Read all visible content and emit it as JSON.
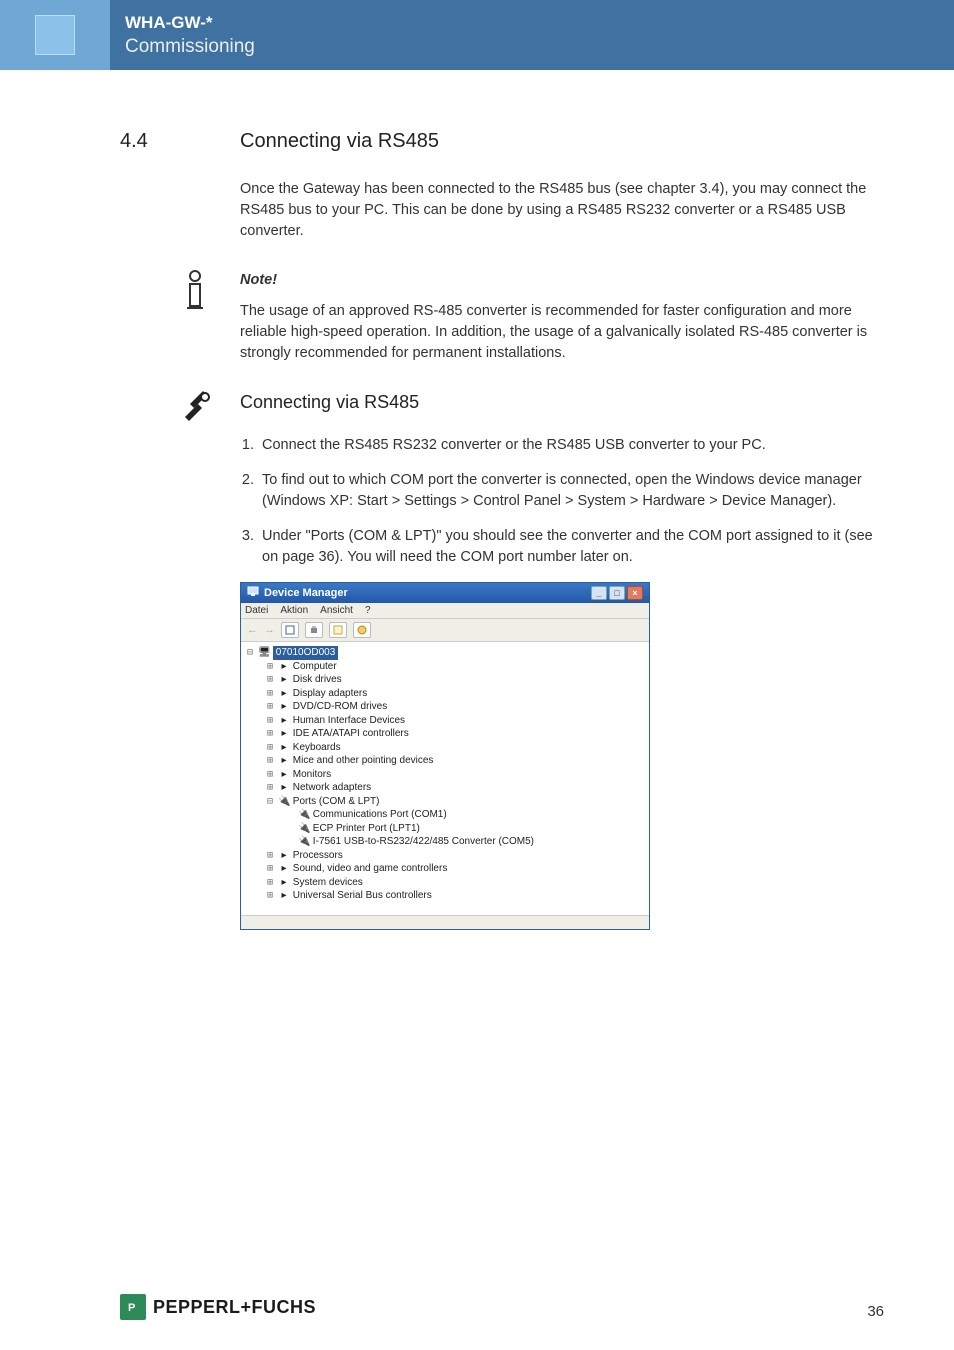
{
  "header": {
    "title": "WHA-GW-*",
    "subtitle": "Commissioning"
  },
  "section": {
    "num": "4.4",
    "title": "Connecting via RS485"
  },
  "intro": "Once the Gateway has been connected to the RS485 bus (see chapter 3.4), you may connect the RS485 bus to your PC. This can be done by using a RS485  RS232 converter or a RS485  USB converter.",
  "note": {
    "label": "Note!",
    "body": "The usage of an approved RS-485 converter is recommended for faster configuration and more reliable high-speed operation. In addition, the usage of a galvanically isolated RS-485 converter is strongly recommended for permanent installations."
  },
  "subheading": "Connecting via RS485",
  "steps": [
    "Connect the RS485  RS232 converter or the RS485  USB converter to your PC.",
    "To find out to which COM port the converter is connected, open the Windows   device manager (Windows XP: Start > Settings > Control Panel > System > Hardware > Device Manager).",
    "Under \"Ports (COM & LPT)\" you should see the converter and the COM port assigned to it (see  on page 36). You will need the COM port number later on."
  ],
  "devmgr": {
    "title": "Device Manager",
    "menu": [
      "Datei",
      "Aktion",
      "Ansicht",
      "?"
    ],
    "root": "07010OD003",
    "nodes": [
      "Computer",
      "Disk drives",
      "Display adapters",
      "DVD/CD-ROM drives",
      "Human Interface Devices",
      "IDE ATA/ATAPI controllers",
      "Keyboards",
      "Mice and other pointing devices",
      "Monitors",
      "Network adapters"
    ],
    "ports_label": "Ports (COM & LPT)",
    "ports_children": [
      "Communications Port (COM1)",
      "ECP Printer Port (LPT1)",
      "I-7561 USB-to-RS232/422/485 Converter (COM5)"
    ],
    "nodes_after": [
      "Processors",
      "Sound, video and game controllers",
      "System devices",
      "Universal Serial Bus controllers"
    ]
  },
  "footer": {
    "brand": "PEPPERL+FUCHS",
    "page": "36"
  }
}
